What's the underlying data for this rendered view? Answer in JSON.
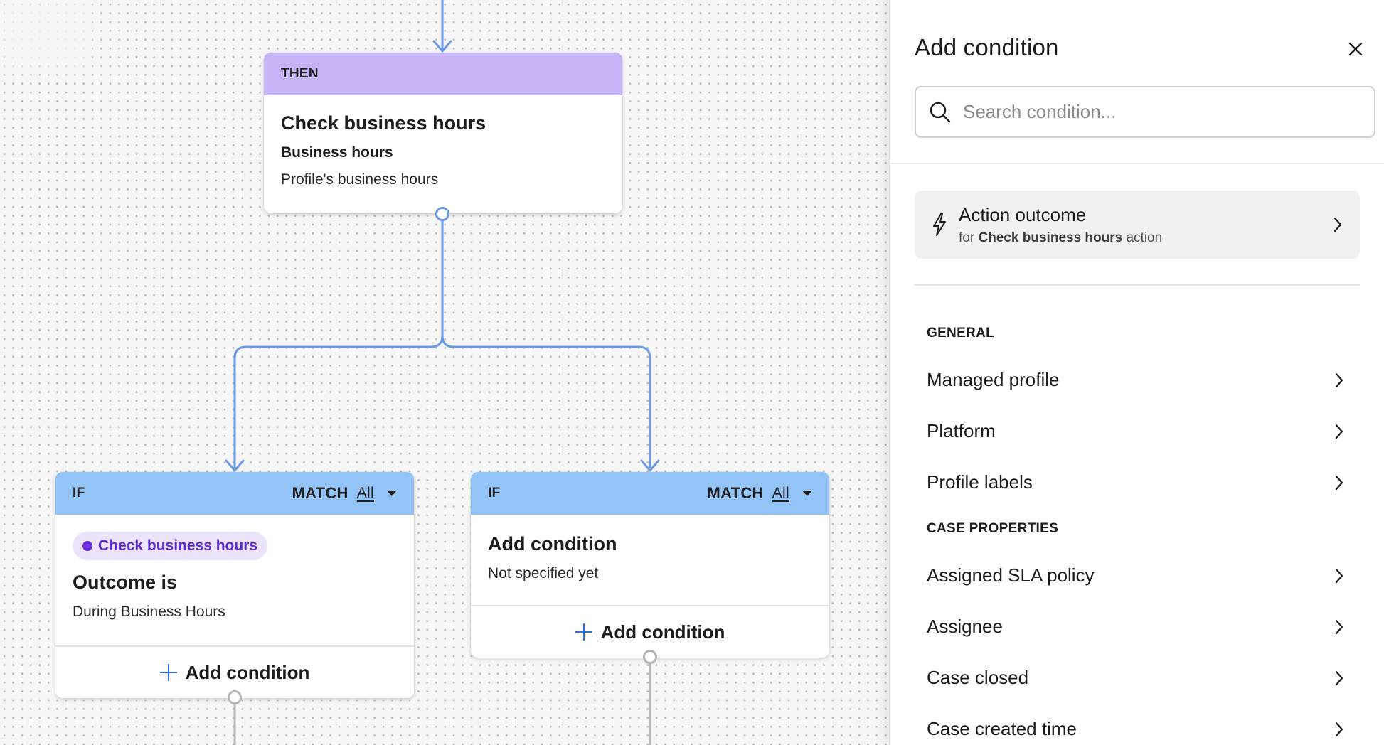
{
  "canvas": {
    "then_node": {
      "header": "THEN",
      "title": "Check business hours",
      "subtitle": "Business hours",
      "text": "Profile's business hours"
    },
    "if_nodes": [
      {
        "header": "IF",
        "match_label": "MATCH",
        "match_value": "All",
        "pill": "Check business hours",
        "title": "Outcome is",
        "text": "During Business Hours",
        "footer": "Add condition"
      },
      {
        "header": "IF",
        "match_label": "MATCH",
        "match_value": "All",
        "title": "Add condition",
        "text": "Not specified yet",
        "footer": "Add condition"
      }
    ]
  },
  "panel": {
    "title": "Add condition",
    "search": {
      "placeholder": "Search condition..."
    },
    "action_outcome": {
      "title": "Action outcome",
      "sub_prefix": "for",
      "sub_bold": "Check business hours",
      "sub_suffix": "action"
    },
    "sections": [
      {
        "header": "GENERAL",
        "items": [
          "Managed profile",
          "Platform",
          "Profile labels"
        ]
      },
      {
        "header": "CASE PROPERTIES",
        "items": [
          "Assigned SLA policy",
          "Assignee",
          "Case closed",
          "Case created time"
        ]
      }
    ]
  },
  "colors": {
    "then_header": "#c7b4f7",
    "if_header": "#93c4f8",
    "wire": "#6a9ae8",
    "pill_bg": "#ece4fd",
    "pill_text": "#5b2bd3",
    "plus": "#2f6fdc"
  },
  "icons": [
    "search-icon",
    "close-icon",
    "lightning-icon",
    "chevron-right-icon",
    "plus-icon",
    "caret-down-icon"
  ]
}
